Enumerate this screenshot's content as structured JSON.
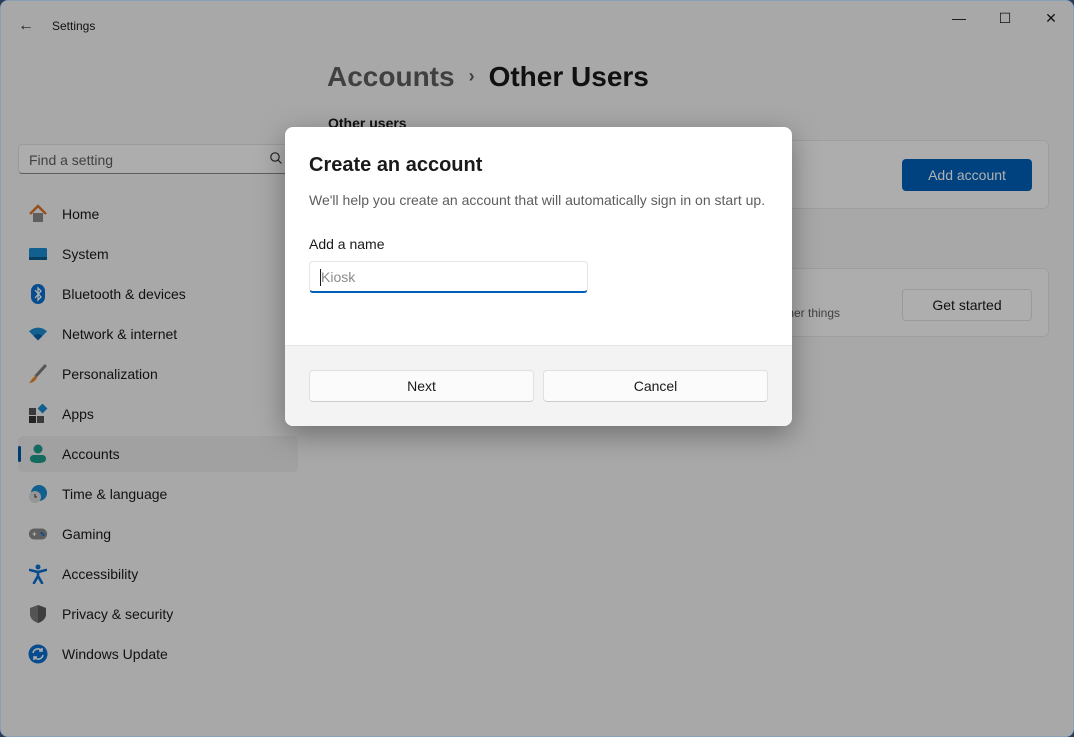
{
  "window": {
    "title": "Settings",
    "controls": {
      "minimize": "—",
      "maximize": "☐",
      "close": "✕"
    }
  },
  "search": {
    "placeholder": "Find a setting",
    "icon": "search-icon"
  },
  "sidebar": {
    "items": [
      {
        "label": "Home",
        "icon": "home-icon",
        "active": false
      },
      {
        "label": "System",
        "icon": "system-icon",
        "active": false
      },
      {
        "label": "Bluetooth & devices",
        "icon": "bluetooth-icon",
        "active": false
      },
      {
        "label": "Network & internet",
        "icon": "wifi-icon",
        "active": false
      },
      {
        "label": "Personalization",
        "icon": "brush-icon",
        "active": false
      },
      {
        "label": "Apps",
        "icon": "apps-icon",
        "active": false
      },
      {
        "label": "Accounts",
        "icon": "person-icon",
        "active": true
      },
      {
        "label": "Time & language",
        "icon": "globe-clock-icon",
        "active": false
      },
      {
        "label": "Gaming",
        "icon": "gamepad-icon",
        "active": false
      },
      {
        "label": "Accessibility",
        "icon": "accessibility-icon",
        "active": false
      },
      {
        "label": "Privacy & security",
        "icon": "shield-icon",
        "active": false
      },
      {
        "label": "Windows Update",
        "icon": "update-icon",
        "active": false
      }
    ]
  },
  "main": {
    "breadcrumb": {
      "parent": "Accounts",
      "separator": "›",
      "current": "Other Users"
    },
    "section_label": "Other users",
    "add_account_button": "Add account",
    "kiosk_card": {
      "desc_fragment": "ther things",
      "button": "Get started"
    }
  },
  "dialog": {
    "title": "Create an account",
    "subtitle": "We'll help you create an account that will automatically sign in on start up.",
    "field_label": "Add a name",
    "input_value": "",
    "input_placeholder": "Kiosk",
    "next_button": "Next",
    "cancel_button": "Cancel"
  },
  "colors": {
    "accent": "#005fb8",
    "active_indicator": "#0058a8"
  }
}
